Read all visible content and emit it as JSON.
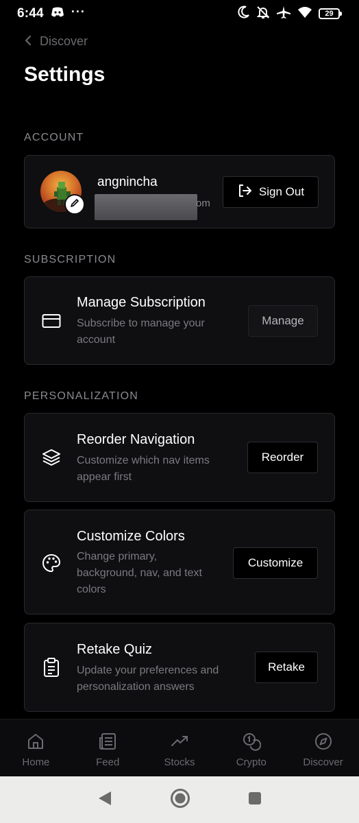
{
  "status_bar": {
    "time": "6:44",
    "more": "···",
    "battery": "29"
  },
  "header": {
    "back_label": "Discover",
    "title": "Settings"
  },
  "account": {
    "section_label": "ACCOUNT",
    "username": "angnincha",
    "email_tail": "om",
    "sign_out_label": "Sign Out"
  },
  "subscription": {
    "section_label": "SUBSCRIPTION",
    "title": "Manage Subscription",
    "description_line1": "Subscribe to manage your",
    "description_line2": "account",
    "button_label": "Manage"
  },
  "personalization": {
    "section_label": "PERSONALIZATION",
    "items": [
      {
        "title": "Reorder Navigation",
        "description_line1": "Customize which nav items",
        "description_line2": "appear first",
        "button_label": "Reorder",
        "icon": "layers-icon"
      },
      {
        "title": "Customize Colors",
        "description_line1": "Change primary,",
        "description_line2": "background, nav, and text",
        "description_line3": "colors",
        "button_label": "Customize",
        "icon": "palette-icon"
      },
      {
        "title": "Retake Quiz",
        "description_line1": "Update your preferences and",
        "description_line2": "personalization answers",
        "button_label": "Retake",
        "icon": "clipboard-icon"
      }
    ]
  },
  "bottom_nav": {
    "items": [
      {
        "label": "Home",
        "icon": "home-icon"
      },
      {
        "label": "Feed",
        "icon": "newspaper-icon"
      },
      {
        "label": "Stocks",
        "icon": "trending-up-icon"
      },
      {
        "label": "Crypto",
        "icon": "coins-icon"
      },
      {
        "label": "Discover",
        "icon": "compass-icon"
      }
    ]
  },
  "colors": {
    "background": "#000000",
    "card": "#0f0f11",
    "border": "#2b2b30",
    "muted_text": "#7b7b80"
  }
}
